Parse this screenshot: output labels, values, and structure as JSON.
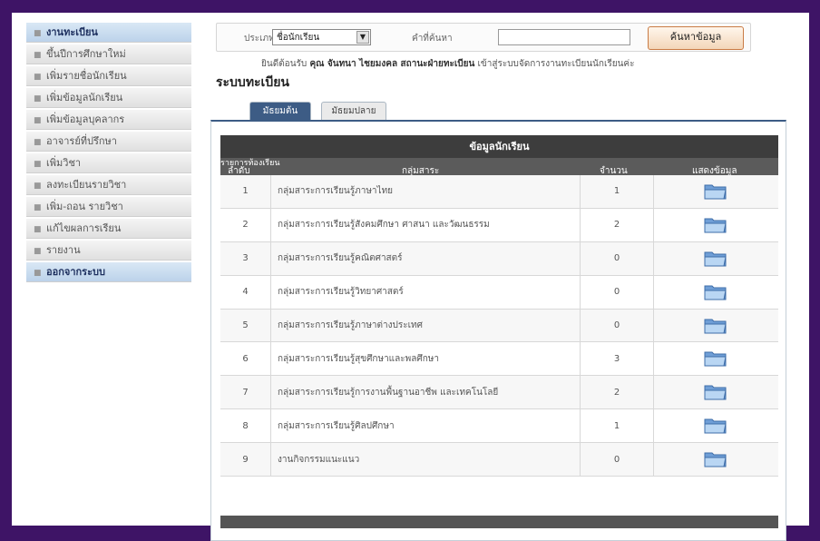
{
  "sidebar": {
    "items": [
      {
        "label": "งานทะเบียน",
        "style": "blue"
      },
      {
        "label": "ขึ้นปีการศึกษาใหม่",
        "style": "gray"
      },
      {
        "label": "เพิ่มรายชื่อนักเรียน",
        "style": "gray"
      },
      {
        "label": "เพิ่มข้อมูลนักเรียน",
        "style": "gray"
      },
      {
        "label": "เพิ่มข้อมูลบุคลากร",
        "style": "gray"
      },
      {
        "label": "อาจารย์ที่ปรึกษา",
        "style": "gray"
      },
      {
        "label": "เพิ่มวิชา",
        "style": "gray"
      },
      {
        "label": "ลงทะเบียนรายวิชา",
        "style": "gray"
      },
      {
        "label": "เพิ่ม-ถอน รายวิชา",
        "style": "gray"
      },
      {
        "label": "แก้ไขผลการเรียน",
        "style": "gray"
      },
      {
        "label": "รายงาน",
        "style": "gray"
      },
      {
        "label": "ออกจากระบบ",
        "style": "blue"
      }
    ]
  },
  "search": {
    "type_label": "ประเภท",
    "type_value": "ชื่อนักเรียน",
    "keyword_label": "คำที่ค้นหา",
    "keyword_value": "",
    "button_label": "ค้นหาข้อมูล"
  },
  "welcome": {
    "prefix": "ยินดีต้อนรับ",
    "name": "คุณ จันทนา ไชยมงคล สถานะฝ่ายทะเบียน",
    "suffix": "เข้าสู่ระบบจัดการงานทะเบียนนักเรียนค่ะ"
  },
  "page_title": "ระบบทะเบียน",
  "tabs": [
    {
      "label": "มัธยมต้น",
      "active": true
    },
    {
      "label": "มัธยมปลาย",
      "active": false
    }
  ],
  "table": {
    "title": "ข้อมูลนักเรียน",
    "caption": "รายการท้องเรียน",
    "headers": [
      "ลำดับ",
      "กลุ่มสาระ",
      "จำนวน",
      "แสดงข้อมูล"
    ],
    "rows": [
      {
        "no": "1",
        "subject": "กลุ่มสาระการเรียนรู้ภาษาไทย",
        "count": "1"
      },
      {
        "no": "2",
        "subject": "กลุ่มสาระการเรียนรู้สังคมศึกษา ศาสนา และวัฒนธรรม",
        "count": "2"
      },
      {
        "no": "3",
        "subject": "กลุ่มสาระการเรียนรู้คณิตศาสตร์",
        "count": "0"
      },
      {
        "no": "4",
        "subject": "กลุ่มสาระการเรียนรู้วิทยาศาสตร์",
        "count": "0"
      },
      {
        "no": "5",
        "subject": "กลุ่มสาระการเรียนรู้ภาษาต่างประเทศ",
        "count": "0"
      },
      {
        "no": "6",
        "subject": "กลุ่มสาระการเรียนรู้สุขศึกษาและพลศึกษา",
        "count": "3"
      },
      {
        "no": "7",
        "subject": "กลุ่มสาระการเรียนรู้การงานพื้นฐานอาชีพ และเทคโนโลยี",
        "count": "2"
      },
      {
        "no": "8",
        "subject": "กลุ่มสาระการเรียนรู้ศิลปศึกษา",
        "count": "1"
      },
      {
        "no": "9",
        "subject": "งานกิจกรรมแนะแนว",
        "count": "0"
      }
    ],
    "action_icon": "folder-icon"
  },
  "colors": {
    "page_border": "#3e1466",
    "accent": "#3d5c85",
    "table_header": "#3d3d3d",
    "button_border": "#c97b45"
  }
}
